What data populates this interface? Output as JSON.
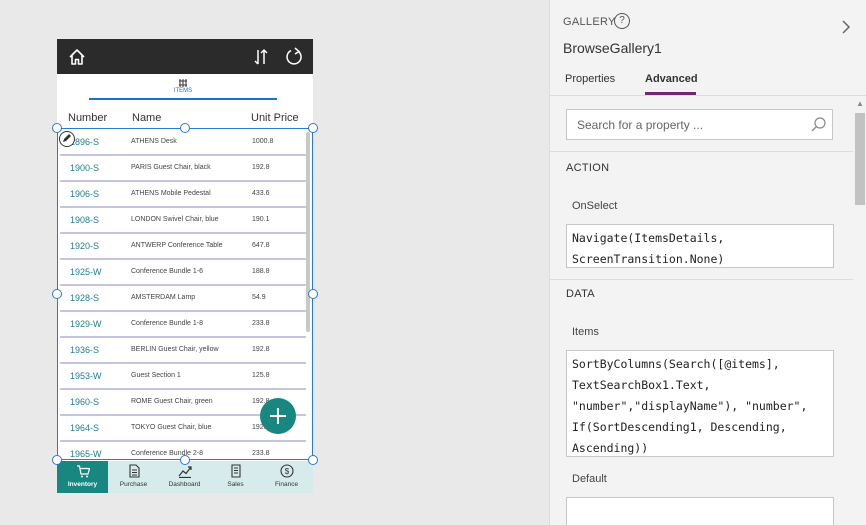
{
  "app": {
    "tab_label": "ITEMS",
    "columns": {
      "number": "Number",
      "name": "Name",
      "price": "Unit Price"
    },
    "rows": [
      {
        "number": "1896-S",
        "name": "ATHENS Desk",
        "price": "1000.8"
      },
      {
        "number": "1900-S",
        "name": "PARIS Guest Chair, black",
        "price": "192.8"
      },
      {
        "number": "1906-S",
        "name": "ATHENS Mobile Pedestal",
        "price": "433.6"
      },
      {
        "number": "1908-S",
        "name": "LONDON Swivel Chair, blue",
        "price": "190.1"
      },
      {
        "number": "1920-S",
        "name": "ANTWERP Conference Table",
        "price": "647.8"
      },
      {
        "number": "1925-W",
        "name": "Conference Bundle 1-6",
        "price": "188.8"
      },
      {
        "number": "1928-S",
        "name": "AMSTERDAM Lamp",
        "price": "54.9"
      },
      {
        "number": "1929-W",
        "name": "Conference Bundle 1-8",
        "price": "233.8"
      },
      {
        "number": "1936-S",
        "name": "BERLIN Guest Chair, yellow",
        "price": "192.8"
      },
      {
        "number": "1953-W",
        "name": "Guest Section 1",
        "price": "125.8"
      },
      {
        "number": "1960-S",
        "name": "ROME Guest Chair, green",
        "price": "192.8"
      },
      {
        "number": "1964-S",
        "name": "TOKYO Guest Chair, blue",
        "price": "192.8"
      },
      {
        "number": "1965-W",
        "name": "Conference Bundle 2-8",
        "price": "233.8"
      }
    ],
    "nav": [
      {
        "label": "Inventory",
        "icon": "cart-icon"
      },
      {
        "label": "Purchase",
        "icon": "document-icon"
      },
      {
        "label": "Dashboard",
        "icon": "chart-line-icon"
      },
      {
        "label": "Sales",
        "icon": "receipt-icon"
      },
      {
        "label": "Finance",
        "icon": "dollar-icon"
      }
    ],
    "colors": {
      "accent": "#17877f",
      "link": "#1d7f8f",
      "selection": "#2b7ad1"
    }
  },
  "panel": {
    "type_label": "GALLERY",
    "control_name": "BrowseGallery1",
    "tabs": {
      "properties": "Properties",
      "advanced": "Advanced"
    },
    "search_placeholder": "Search for a property ...",
    "sections": {
      "action": "ACTION",
      "data": "DATA"
    },
    "props": {
      "onselect_label": "OnSelect",
      "onselect_formula": "Navigate(ItemsDetails,\nScreenTransition.None)",
      "items_label": "Items",
      "items_formula": "SortByColumns(Search([@items],\nTextSearchBox1.Text,\n\"number\",\"displayName\"), \"number\",\nIf(SortDescending1, Descending,\nAscending))",
      "default_label": "Default",
      "default_formula": ""
    },
    "colors": {
      "tab_underline": "#742774"
    }
  }
}
